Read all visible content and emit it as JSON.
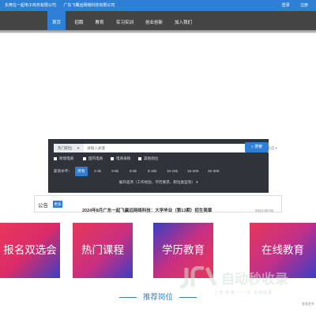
{
  "topbar": {
    "companies": [
      "东莞在一起电子商务有限公司",
      "广东飞鹰远网络科技有限公司"
    ],
    "login": "登录",
    "register": "注册",
    "bg_color": "#2e7fd6"
  },
  "nav": {
    "items": [
      {
        "label": "首页",
        "active": true
      },
      {
        "label": "招聘"
      },
      {
        "label": "教育"
      },
      {
        "label": "实习实训"
      },
      {
        "label": "创业创新"
      },
      {
        "label": "加入我们"
      }
    ],
    "bg_color": "#444444",
    "active_color": "#2e7fd6"
  },
  "search": {
    "select_value": "热门职位",
    "input_placeholder": "请输入关键",
    "filter_label": "筛选",
    "button_label": "搜索",
    "checkboxes": [
      "跨境电商",
      "国内电商",
      "电商采购",
      "其他岗位"
    ],
    "salary_label": "薪资水平：",
    "salary_options": [
      "所有",
      "2-3k",
      "3-5k",
      "5-8k",
      "8-10k",
      "10-15k",
      "15-20K",
      "20-30K"
    ],
    "expand_label": "展开选项（工作经验、学历要求、职位类型等）"
  },
  "notice": {
    "label": "公告",
    "more": "更多",
    "text": "2024年8月广东一起飞赢远网络科技：大学毕业（第13期）招生简章",
    "date": "2024-08-06"
  },
  "banners": [
    "报名双选会",
    "热门课程",
    "学历教育",
    "在线教育"
  ],
  "recommend": {
    "title": "推荐岗位"
  },
  "watermark": {
    "title": "自动秒收录",
    "subtitle": "上线·秒排·一一次·自动收录"
  },
  "corner_text": "查看更多"
}
